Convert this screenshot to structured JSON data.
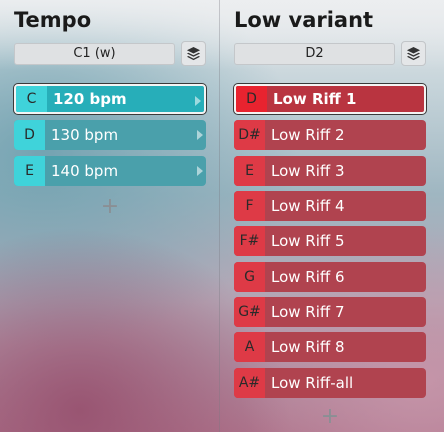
{
  "left": {
    "title": "Tempo",
    "dropdown_value": "C1 (w)",
    "layers_icon": "layers-icon",
    "items": [
      {
        "note": "C",
        "label": "120 bpm",
        "selected": true
      },
      {
        "note": "D",
        "label": "130 bpm"
      },
      {
        "note": "E",
        "label": "140 bpm"
      }
    ],
    "add_label": "+"
  },
  "right": {
    "title": "Low variant",
    "dropdown_value": "D2",
    "layers_icon": "layers-icon",
    "items": [
      {
        "note": "D",
        "label": "Low Riff 1",
        "selected": true
      },
      {
        "note": "D#",
        "label": "Low Riff 2"
      },
      {
        "note": "E",
        "label": "Low Riff 3"
      },
      {
        "note": "F",
        "label": "Low Riff 4"
      },
      {
        "note": "F#",
        "label": "Low Riff 5"
      },
      {
        "note": "G",
        "label": "Low Riff 6"
      },
      {
        "note": "G#",
        "label": "Low Riff 7"
      },
      {
        "note": "A",
        "label": "Low Riff 8"
      },
      {
        "note": "A#",
        "label": "Low Riff-all"
      }
    ],
    "add_label": "+"
  },
  "colors": {
    "tempo_item": "#4aa0ab",
    "tempo_note": "#3fd3da",
    "variant_item": "#b0434f",
    "variant_note": "#de3a46"
  }
}
